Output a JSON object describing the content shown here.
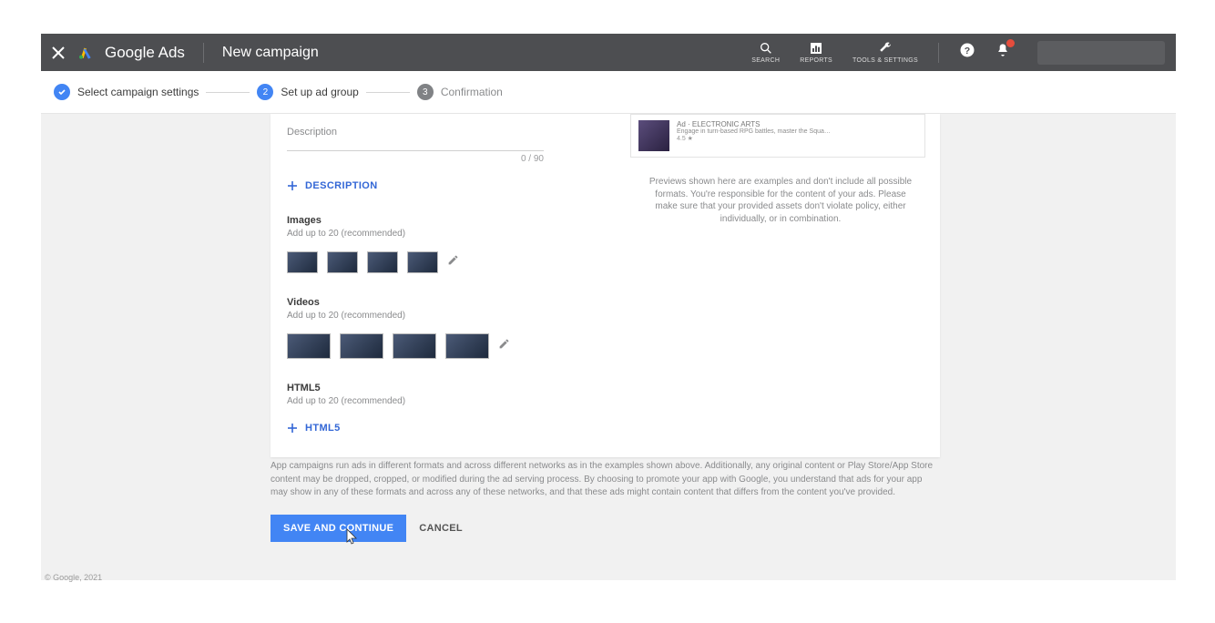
{
  "topbar": {
    "brand1": "Google",
    "brand2": " Ads",
    "title": "New campaign",
    "search_label": "SEARCH",
    "reports_label": "REPORTS",
    "tools_label": "TOOLS & SETTINGS"
  },
  "stepper": {
    "s1": "Select campaign settings",
    "s2": "Set up ad group",
    "s2_num": "2",
    "s3": "Confirmation",
    "s3_num": "3"
  },
  "form": {
    "description_label": "Description",
    "desc_counter": "0 / 90",
    "add_description": "DESCRIPTION",
    "images_title": "Images",
    "images_sub": "Add up to 20 (recommended)",
    "videos_title": "Videos",
    "videos_sub": "Add up to 20 (recommended)",
    "html5_title": "HTML5",
    "html5_sub": "Add up to 20 (recommended)",
    "add_html5": "HTML5"
  },
  "preview": {
    "ad_label": "Ad · ELECTRONIC ARTS",
    "ad_desc": "Engage in turn-based RPG battles, master the Squa…",
    "ad_rating": "4.5 ★",
    "disclaimer": "Previews shown here are examples and don't include all possible formats. You're responsible for the content of your ads. Please make sure that your provided assets don't violate policy, either individually, or in combination."
  },
  "bottom": {
    "disclaimer": "App campaigns run ads in different formats and across different networks as in the examples shown above. Additionally, any original content or Play Store/App Store content may be dropped, cropped, or modified during the ad serving process. By choosing to promote your app with Google, you understand that ads for your app may show in any of these formats and across any of these networks, and that these ads might contain content that differs from the content you've provided.",
    "save": "SAVE AND CONTINUE",
    "cancel": "CANCEL"
  },
  "footer": "© Google, 2021"
}
